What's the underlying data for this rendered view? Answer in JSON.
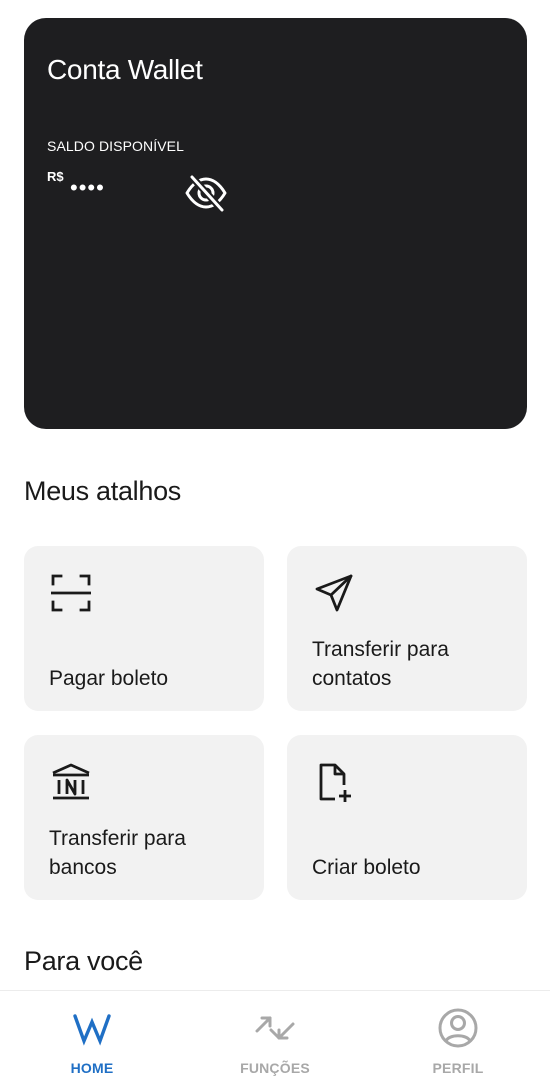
{
  "wallet_card": {
    "title": "Conta Wallet",
    "balance_label": "SALDO DISPONÍVEL",
    "currency": "R$",
    "masked_balance": "••••",
    "visibility_icon": "eye-off-icon"
  },
  "shortcuts": {
    "title": "Meus atalhos",
    "items": [
      {
        "label": "Pagar boleto",
        "icon": "barcode-scan-icon"
      },
      {
        "label": "Transferir para contatos",
        "icon": "send-icon"
      },
      {
        "label": "Transferir para bancos",
        "icon": "bank-icon"
      },
      {
        "label": "Criar boleto",
        "icon": "file-add-icon"
      }
    ]
  },
  "for_you": {
    "title": "Para você"
  },
  "bottom_nav": {
    "items": [
      {
        "label": "HOME",
        "icon": "wallet-logo-icon",
        "active": true
      },
      {
        "label": "FUNÇÕES",
        "icon": "arrows-swap-icon",
        "active": false
      },
      {
        "label": "PERFIL",
        "icon": "user-circle-icon",
        "active": false
      }
    ]
  },
  "colors": {
    "card_background": "#1e1e20",
    "tile_background": "#f2f2f2",
    "accent": "#1f6fc5",
    "nav_inactive": "#a8a8a8"
  }
}
